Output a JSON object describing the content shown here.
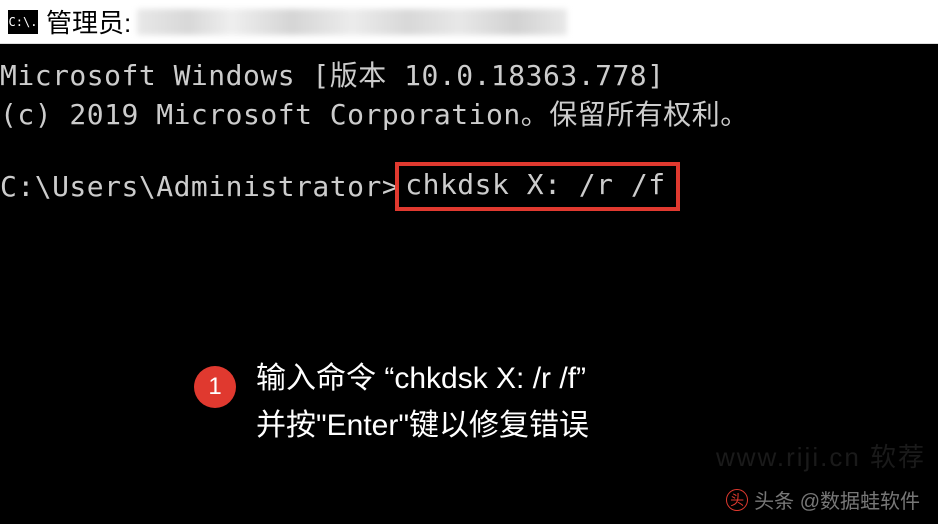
{
  "window": {
    "icon_text": "C:\\.",
    "title_prefix": "管理员:"
  },
  "terminal": {
    "line1": "Microsoft Windows [版本 10.0.18363.778]",
    "line2": "(c) 2019 Microsoft Corporation。保留所有权利。",
    "prompt": "C:\\Users\\Administrator>",
    "command": "chkdsk X: /r /f"
  },
  "callout": {
    "number": "1",
    "text": "输入命令 “chkdsk X: /r /f”\n并按\"Enter\"键以修复错误"
  },
  "watermark": "www.riji.cn 软荐",
  "attribution": {
    "label": "头条",
    "handle": "@数据蛙软件"
  }
}
